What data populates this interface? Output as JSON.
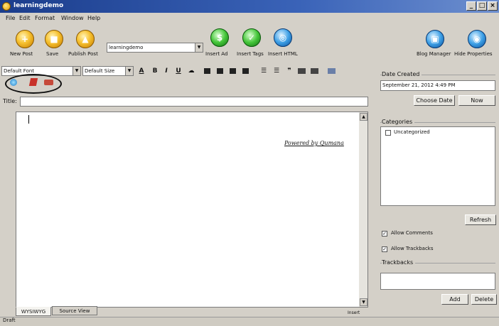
{
  "window": {
    "title": "learningdemo",
    "controls": {
      "minimize": "_",
      "maximize": "□",
      "close": "×"
    }
  },
  "menu": [
    "File",
    "Edit",
    "Format",
    "Window",
    "Help"
  ],
  "toolbar": {
    "buttons": [
      {
        "label": "New Post",
        "icon": "new-post-icon",
        "glyph": "+"
      },
      {
        "label": "Save",
        "icon": "save-icon",
        "glyph": "■"
      },
      {
        "label": "Publish Post",
        "icon": "publish-icon",
        "glyph": "▲"
      }
    ],
    "blog_select_value": "learningdemo",
    "insert_buttons": [
      {
        "label": "Insert Ad",
        "icon": "insert-ad-icon",
        "glyph": "$"
      },
      {
        "label": "Insert Tags",
        "icon": "insert-tags-icon",
        "glyph": "✓"
      },
      {
        "label": "Insert HTML",
        "icon": "insert-html-icon",
        "glyph": "◎"
      }
    ],
    "right_buttons": [
      {
        "label": "Blog Manager",
        "icon": "blog-manager-icon",
        "glyph": "▣"
      },
      {
        "label": "Hide Properties",
        "icon": "hide-properties-icon",
        "glyph": "◉"
      }
    ]
  },
  "format": {
    "font_value": "Default Font",
    "size_value": "Default Size",
    "letters": {
      "color": "A",
      "bold": "B",
      "italic": "I",
      "underline": "U"
    }
  },
  "title_label": "Title:",
  "editor": {
    "watermark": "Powered by Qumana"
  },
  "tabs": [
    "WYSIWYG",
    "Source View"
  ],
  "mode_indicator": "Insert",
  "status": "Draft",
  "sidebar": {
    "date_label": "Date Created",
    "date_value": "September 21, 2012 4:49 PM",
    "choose_date": "Choose Date",
    "now": "Now",
    "categories_label": "Categories",
    "categories": [
      {
        "name": "Uncategorized",
        "checked": false
      }
    ],
    "refresh": "Refresh",
    "allow_comments": {
      "label": "Allow Comments",
      "checked": true
    },
    "allow_trackbacks": {
      "label": "Allow Trackbacks",
      "checked": true
    },
    "trackbacks_label": "Trackbacks",
    "add": "Add",
    "delete": "Delete"
  },
  "colors": {
    "titlebar": "#1b3d8c",
    "window": "#d4d0c8",
    "editor_bg": "#ffffff"
  }
}
